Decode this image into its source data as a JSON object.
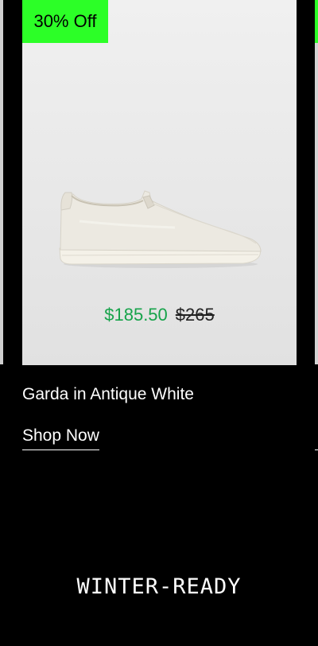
{
  "colors": {
    "badge": "#2cff27",
    "sale_price": "#16a34a",
    "background": "#000000",
    "card": "#e9e9e9"
  },
  "product": {
    "discount_badge": "30% Off",
    "image_icon": "slip-on-sneaker-image",
    "sale_price": "$185.50",
    "original_price": "$265",
    "name": "Garda in Antique White",
    "cta_label": "Shop Now"
  },
  "section": {
    "heading": "WINTER-READY"
  }
}
